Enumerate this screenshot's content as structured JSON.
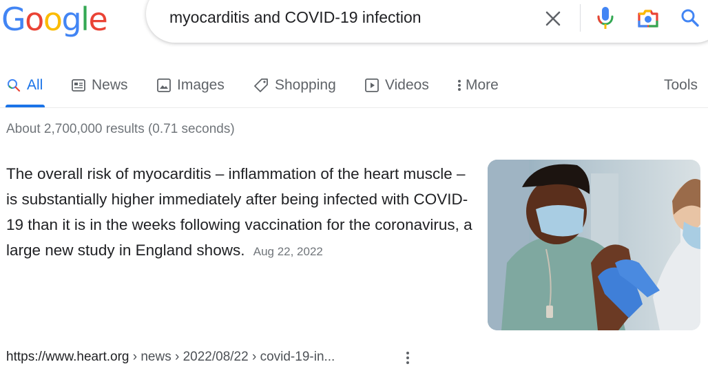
{
  "logo": {
    "text": "Google",
    "letters": [
      "G",
      "o",
      "o",
      "g",
      "l",
      "e"
    ],
    "colors": [
      "#4285f4",
      "#ea4335",
      "#fbbc05",
      "#4285f4",
      "#34a853",
      "#ea4335"
    ]
  },
  "search": {
    "query": "myocarditis and COVID-19 infection"
  },
  "icons": {
    "clear": "close-icon",
    "mic": "microphone-icon",
    "lens": "camera-lens-icon",
    "search": "search-icon"
  },
  "tabs": [
    {
      "label": "All",
      "icon": "search-icon",
      "active": true
    },
    {
      "label": "News",
      "icon": "newspaper-icon"
    },
    {
      "label": "Images",
      "icon": "image-icon"
    },
    {
      "label": "Shopping",
      "icon": "tag-icon"
    },
    {
      "label": "Videos",
      "icon": "play-icon"
    },
    {
      "label": "More",
      "icon": "kebab-icon"
    }
  ],
  "tools_label": "Tools",
  "result_stats": "About 2,700,000 results (0.71 seconds)",
  "featured_snippet": {
    "text": "The overall risk of myocarditis – inflammation of the heart muscle – is substantially higher immediately after being infected with COVID-19 than it is in the weeks following vaccination for the coronavirus, a large new study in England shows.",
    "date": "Aug 22, 2022",
    "image_subject": "masked-person-receiving-vaccine"
  },
  "result": {
    "domain": "https://www.heart.org",
    "breadcrumb": "› news › 2022/08/22 › covid-19-in..."
  },
  "colors": {
    "accent": "#1a73e8",
    "text": "#202124",
    "muted": "#70757a"
  }
}
